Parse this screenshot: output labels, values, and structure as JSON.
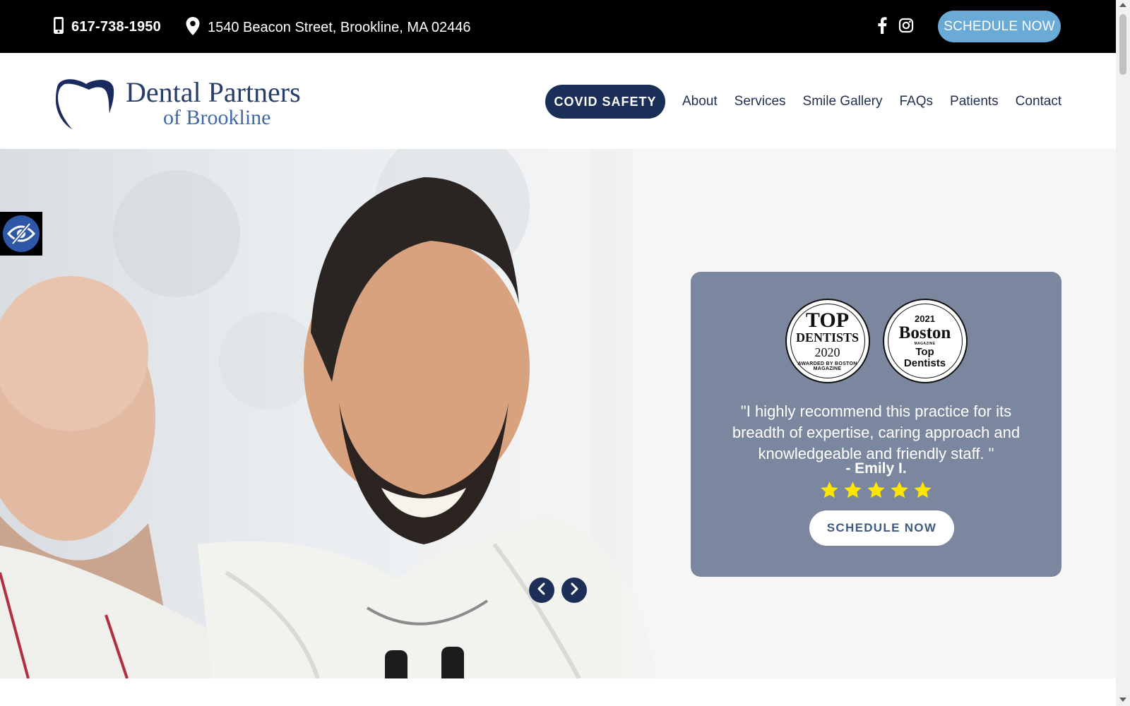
{
  "topbar": {
    "phone": "617-738-1950",
    "address": "1540 Beacon Street, Brookline, MA 02446",
    "social": [
      "facebook-icon",
      "instagram-icon"
    ],
    "schedule_label": "SCHEDULE NOW"
  },
  "header": {
    "logo_line1": "Dental Partners",
    "logo_line2": "of Brookline",
    "covid_label": "COVID SAFETY",
    "nav": [
      "About",
      "Services",
      "Smile Gallery",
      "FAQs",
      "Patients",
      "Contact"
    ]
  },
  "hero": {
    "badge1": {
      "line1": "TOP",
      "line2": "DENTISTS",
      "line3": "2020",
      "line4": "AWARDED BY BOSTON MAGAZINE"
    },
    "badge2": {
      "line1": "2021",
      "line2": "Boston",
      "line3": "MAGAZINE",
      "line4": "Top",
      "line5": "Dentists"
    },
    "quote": "\"I highly recommend this practice for its breadth of expertise, caring approach and knowledgeable and friendly staff. \"",
    "author": "- Emily I.",
    "rating": 5,
    "schedule_label": "SCHEDULE NOW"
  },
  "colors": {
    "topbar_bg": "#000000",
    "accent_blue": "#6aaad7",
    "navy": "#1a2e57",
    "card_bg": "#7b879e",
    "star": "#ffe600"
  }
}
